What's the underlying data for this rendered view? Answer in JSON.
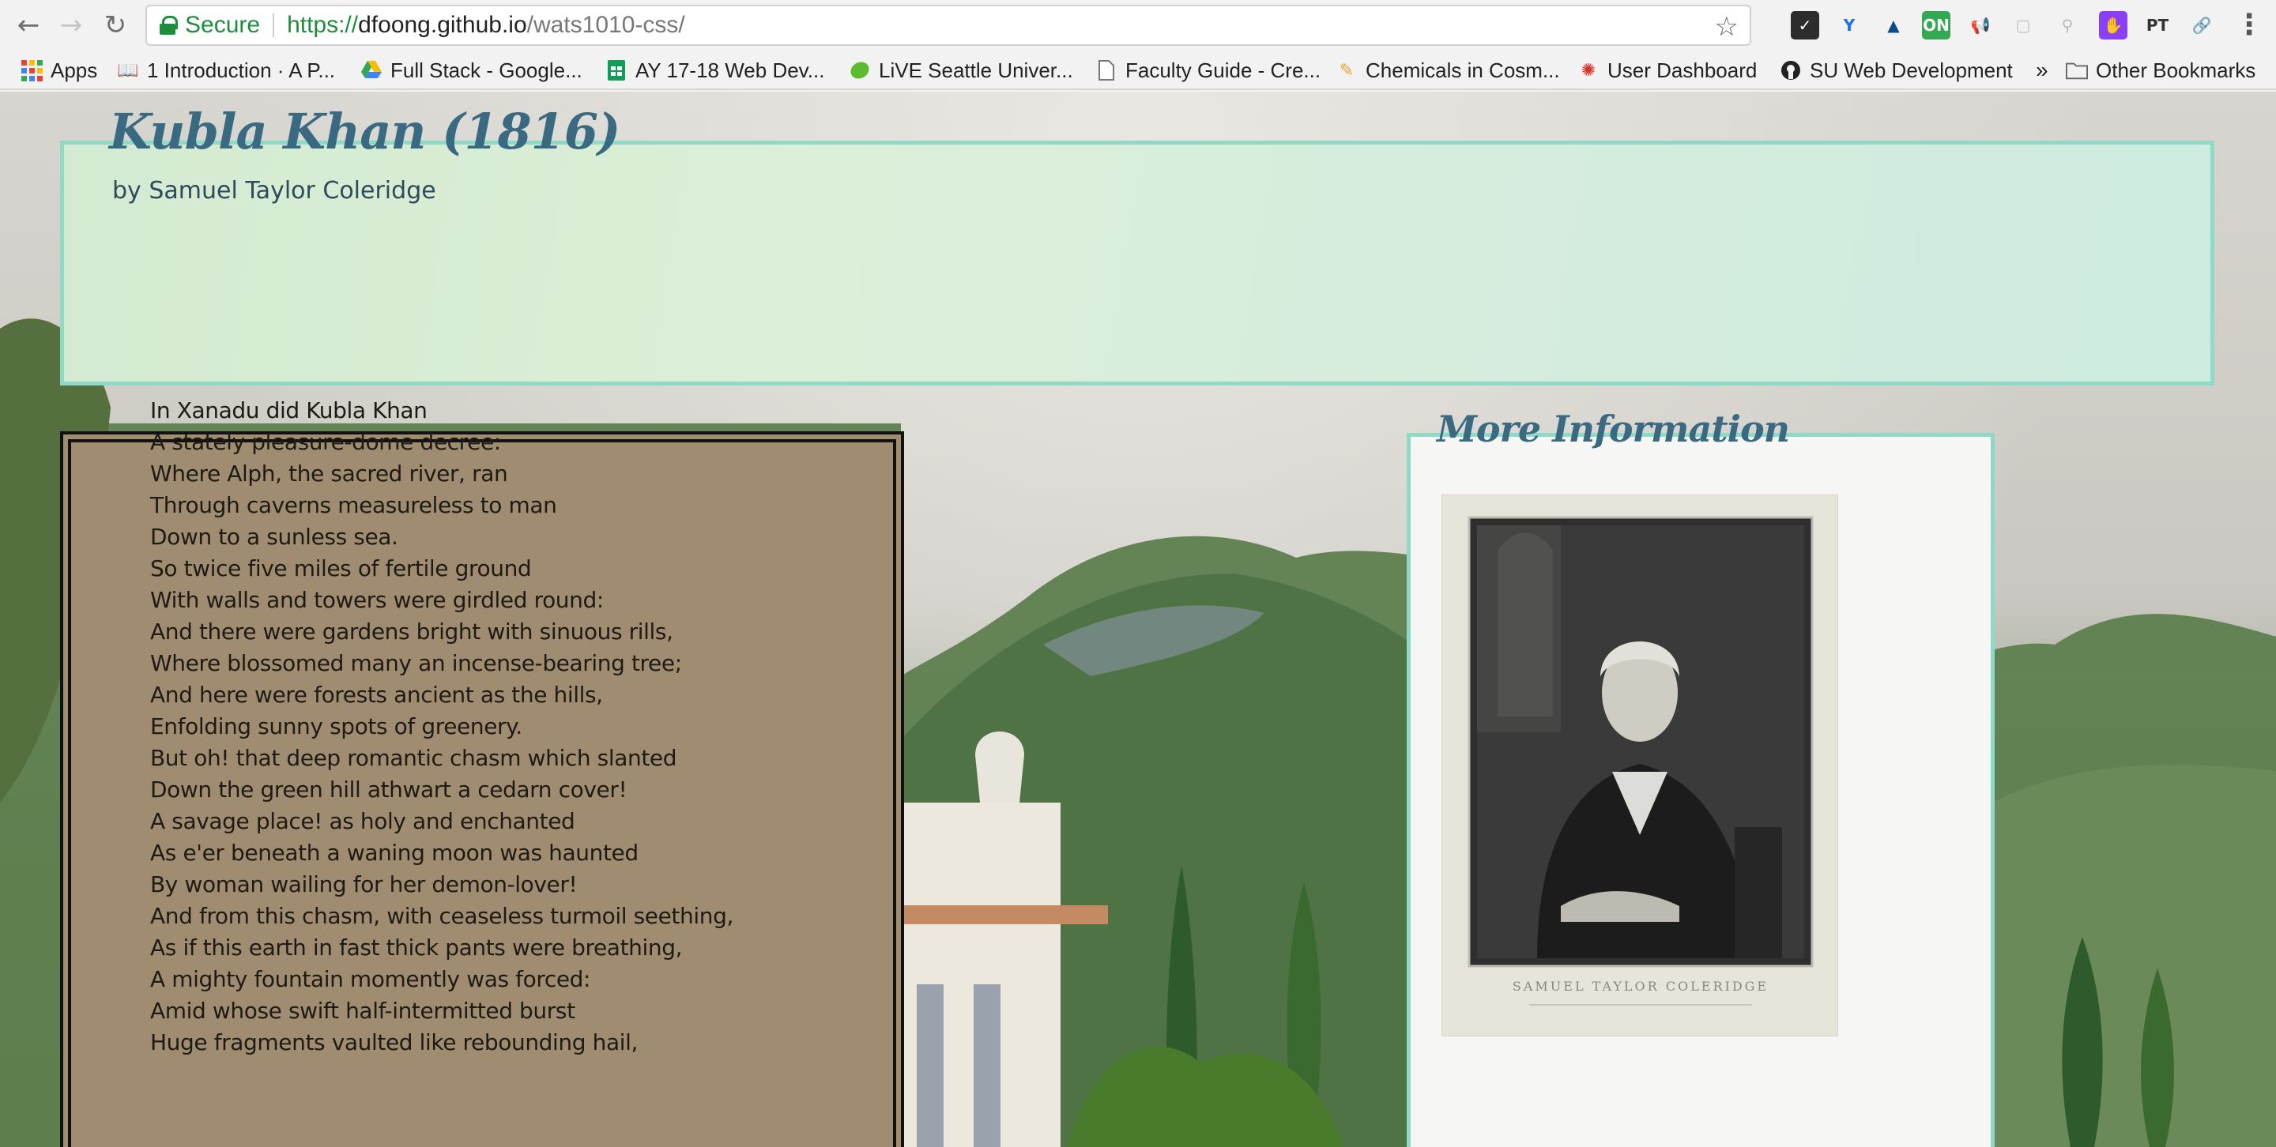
{
  "browser": {
    "security_label": "Secure",
    "url_scheme": "https://",
    "url_host": "dfoong.github.io",
    "url_path": "/wats1010-css/"
  },
  "bookmarks": {
    "items": [
      {
        "label": "Apps"
      },
      {
        "label": "1 Introduction · A P..."
      },
      {
        "label": "Full Stack - Google..."
      },
      {
        "label": "AY 17-18 Web Dev..."
      },
      {
        "label": "LiVE Seattle Univer..."
      },
      {
        "label": "Faculty Guide - Cre..."
      },
      {
        "label": "Chemicals in Cosm..."
      },
      {
        "label": "User Dashboard"
      },
      {
        "label": "SU Web Development"
      }
    ],
    "overflow": "»",
    "other": "Other Bookmarks"
  },
  "extensions": [
    {
      "text": "✓",
      "color": "#2d2d2d"
    },
    {
      "text": "Y",
      "color": "#1a73e8"
    },
    {
      "text": "▲",
      "color": "#0b4a8b"
    },
    {
      "text": "ON",
      "color": "#34a853"
    },
    {
      "text": "📢",
      "color": "#ffffff"
    },
    {
      "text": "▢",
      "color": "#ffffff"
    },
    {
      "text": "⚲",
      "color": "#ffffff"
    },
    {
      "text": "✋",
      "color": "#8a3ffc"
    },
    {
      "text": "PT",
      "color": "#ffffff"
    },
    {
      "text": "🔗",
      "color": "#ffffff"
    }
  ],
  "page": {
    "title": "Kubla Khan (1816)",
    "byline": "by Samuel Taylor Coleridge",
    "poem_lines": [
      "In Xanadu did Kubla Khan",
      "A stately pleasure-dome decree:",
      "Where Alph, the sacred river, ran",
      "Through caverns measureless to man",
      "Down to a sunless sea.",
      "So twice five miles of fertile ground",
      "With walls and towers were girdled round:",
      "And there were gardens bright with sinuous rills,",
      "Where blossomed many an incense-bearing tree;",
      "And here were forests ancient as the hills,",
      "Enfolding sunny spots of greenery.",
      "But oh! that deep romantic chasm which slanted",
      "Down the green hill athwart a cedarn cover!",
      "A savage place! as holy and enchanted",
      "As e'er beneath a waning moon was haunted",
      "By woman wailing for her demon-lover!",
      "And from this chasm, with ceaseless turmoil seething,",
      "As if this earth in fast thick pants were breathing,",
      "A mighty fountain momently was forced:",
      "Amid whose swift half-intermitted burst",
      "Huge fragments vaulted like rebounding hail,"
    ],
    "info_title": "More Information",
    "portrait_caption": "SAMUEL TAYLOR COLERIDGE"
  },
  "colors": {
    "accent_border": "#8fd9c7",
    "title_color": "#3a6a82",
    "poem_background": "#a08c70"
  }
}
